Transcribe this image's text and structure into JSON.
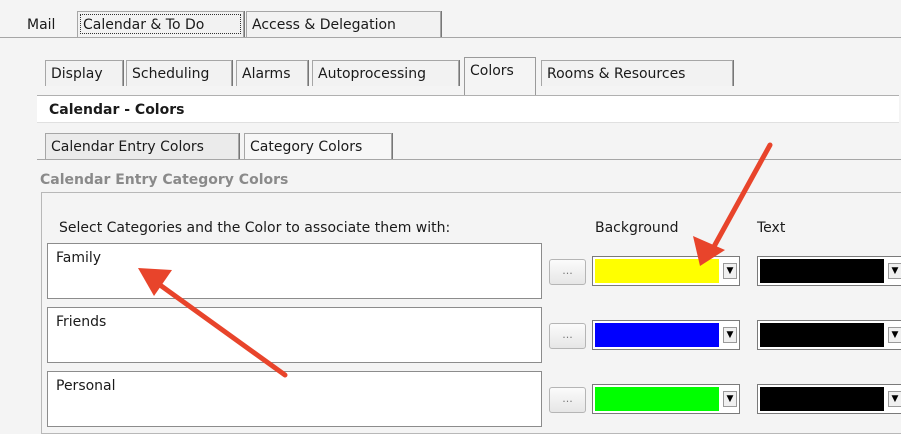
{
  "top_tabs": [
    {
      "label": "Mail"
    },
    {
      "label": "Calendar & To Do"
    },
    {
      "label": "Access & Delegation"
    }
  ],
  "sub_tabs": [
    {
      "label": "Display"
    },
    {
      "label": "Scheduling"
    },
    {
      "label": "Alarms"
    },
    {
      "label": "Autoprocessing"
    },
    {
      "label": "Colors"
    },
    {
      "label": "Rooms & Resources"
    }
  ],
  "panel_title": "Calendar - Colors",
  "color_tabs": [
    {
      "label": "Calendar Entry Colors"
    },
    {
      "label": "Category Colors"
    }
  ],
  "section_label": "Calendar Entry Category Colors",
  "columns": {
    "instruction": "Select Categories and the Color to associate them with:",
    "background": "Background",
    "text": "Text"
  },
  "categories": [
    {
      "name": "Family",
      "background_color": "#ffff00",
      "text_color": "#000000"
    },
    {
      "name": "Friends",
      "background_color": "#0000ff",
      "text_color": "#000000"
    },
    {
      "name": "Personal",
      "background_color": "#00ff00",
      "text_color": "#000000"
    }
  ],
  "picker_button_label": "...",
  "dropdown_arrow": "▼",
  "annotation_color": "#e8442b"
}
